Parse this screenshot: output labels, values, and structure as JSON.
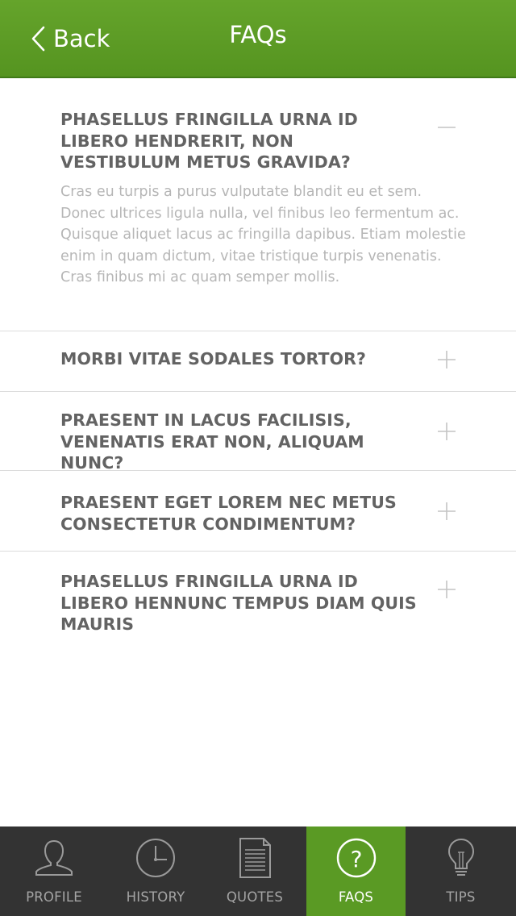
{
  "header": {
    "back_label": "Back",
    "title": "FAQs",
    "background_color": "#5a9a24"
  },
  "faqs": [
    {
      "question": "PHASELLUS FRINGILLA URNA ID LIBERO HENDRERIT, NON VESTIBULUM METUS GRAVIDA?",
      "answer": "Cras eu turpis a purus vulputate blandit eu et sem. Donec ultrices ligula nulla, vel finibus leo fermentum ac. Quisque aliquet lacus ac fringilla dapibus. Etiam molestie enim in quam dictum, vitae tristique turpis venenatis. Cras finibus mi ac quam semper mollis.",
      "expanded": true,
      "toggle_icon": "minus-icon"
    },
    {
      "question": "MORBI VITAE SODALES TORTOR?",
      "expanded": false,
      "toggle_icon": "plus-icon"
    },
    {
      "question": "PRAESENT IN LACUS FACILISIS, VENENATIS ERAT NON, ALIQUAM NUNC?",
      "expanded": false,
      "toggle_icon": "plus-icon"
    },
    {
      "question": "PRAESENT EGET LOREM NEC METUS CONSECTETUR CONDIMENTUM?",
      "expanded": false,
      "toggle_icon": "plus-icon"
    },
    {
      "question": "PHASELLUS FRINGILLA URNA ID LIBERO HENNUNC TEMPUS DIAM QUIS MAURIS",
      "expanded": false,
      "toggle_icon": "plus-icon"
    }
  ],
  "tabbar": {
    "tabs": [
      {
        "label": "PROFILE",
        "icon": "person-icon",
        "active": false
      },
      {
        "label": "HISTORY",
        "icon": "clock-icon",
        "active": false
      },
      {
        "label": "QUOTES",
        "icon": "document-icon",
        "active": false
      },
      {
        "label": "FAQS",
        "icon": "question-icon",
        "active": true
      },
      {
        "label": "TIPS",
        "icon": "lightbulb-icon",
        "active": false
      }
    ],
    "active_color": "#5a9a24",
    "background_color": "#333333"
  }
}
